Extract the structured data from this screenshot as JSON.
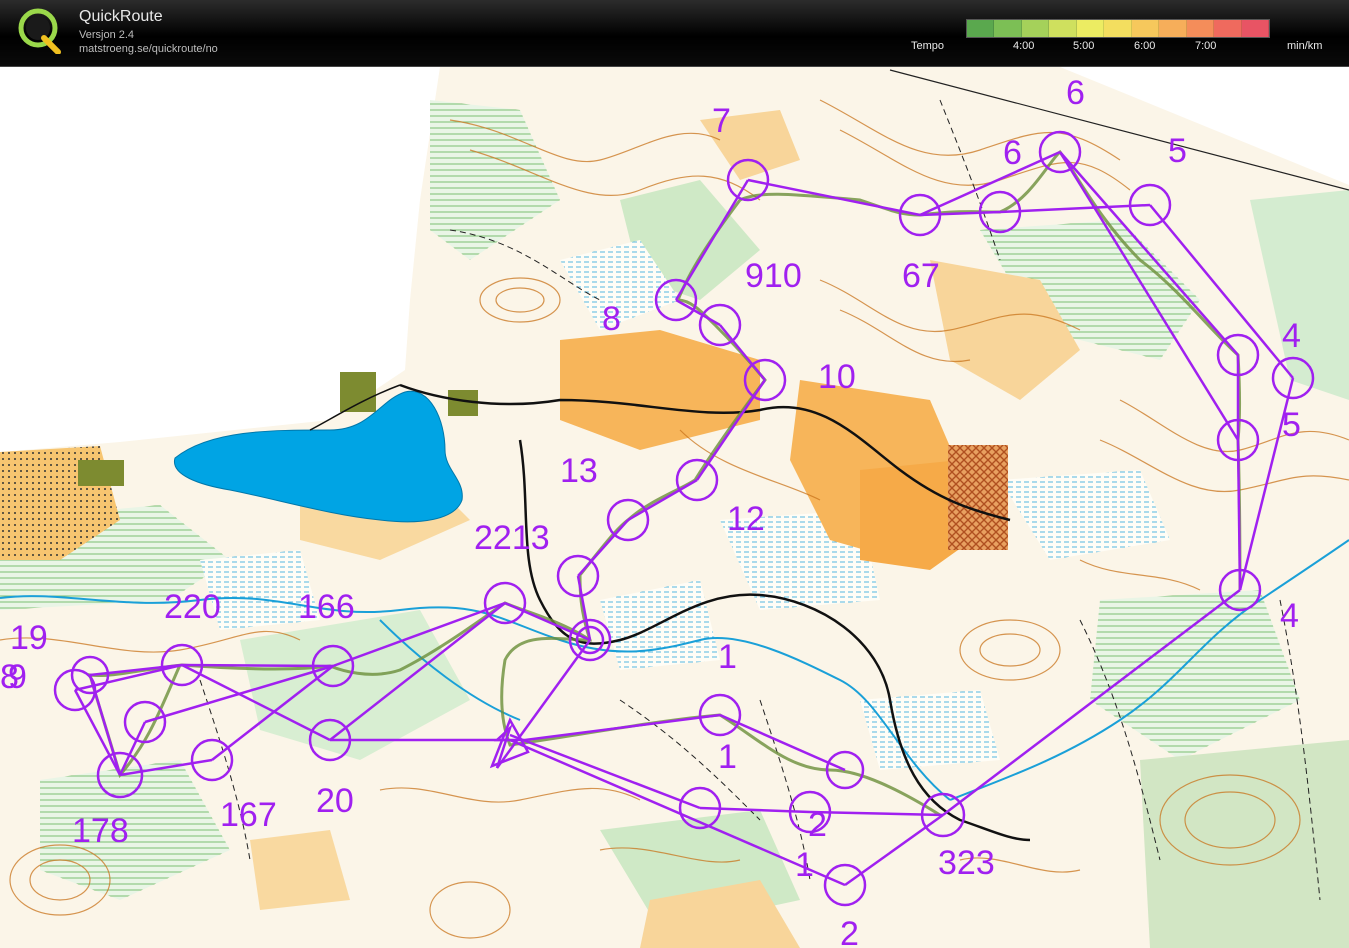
{
  "app": {
    "title": "QuickRoute",
    "version": "Versjon 2.4",
    "url": "matstroeng.se/quickroute/no"
  },
  "legend": {
    "label": "Tempo",
    "ticks": [
      "4:00",
      "5:00",
      "6:00",
      "7:00"
    ],
    "unit": "min/km",
    "colors": [
      "#5aa84e",
      "#7cbf55",
      "#a5d15a",
      "#cfe05e",
      "#ecec62",
      "#f3de5f",
      "#f6c85c",
      "#f6ae5a",
      "#f48d5a",
      "#ef6a5e",
      "#e85464"
    ]
  },
  "map": {
    "control_labels": [
      {
        "text": "1"
      },
      {
        "text": "1"
      },
      {
        "text": "1"
      },
      {
        "text": "2"
      },
      {
        "text": "2"
      },
      {
        "text": "323"
      },
      {
        "text": "4"
      },
      {
        "text": "4"
      },
      {
        "text": "5"
      },
      {
        "text": "5"
      },
      {
        "text": "6"
      },
      {
        "text": "6"
      },
      {
        "text": "67"
      },
      {
        "text": "7"
      },
      {
        "text": "8"
      },
      {
        "text": "8"
      },
      {
        "text": "910"
      },
      {
        "text": "10"
      },
      {
        "text": "12"
      },
      {
        "text": "13"
      },
      {
        "text": "2213"
      },
      {
        "text": "166"
      },
      {
        "text": "220"
      },
      {
        "text": "19"
      },
      {
        "text": "9"
      },
      {
        "text": "178"
      },
      {
        "text": "167"
      },
      {
        "text": "20"
      }
    ],
    "colors": {
      "course": "#a020f0",
      "lake": "#00aaee",
      "open_land": "#f5a623",
      "forest_green": "#8cc88a",
      "contour": "#c9741c"
    }
  }
}
